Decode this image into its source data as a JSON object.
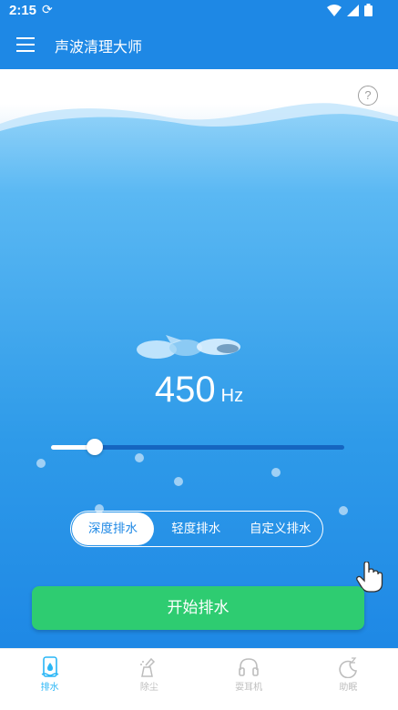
{
  "status": {
    "time": "2:15"
  },
  "app_bar": {
    "title": "声波清理大师"
  },
  "main": {
    "help_label": "?",
    "frequency_value": "450",
    "frequency_unit": "Hz",
    "slider_level": 0.15,
    "modes": [
      {
        "label": "深度排水",
        "active": true
      },
      {
        "label": "轻度排水",
        "active": false
      },
      {
        "label": "自定义排水",
        "active": false
      }
    ],
    "start_button": "开始排水"
  },
  "bottom_nav": [
    {
      "label": "排水",
      "icon": "drain-phone-icon",
      "active": true
    },
    {
      "label": "除尘",
      "icon": "dust-clean-icon",
      "active": false
    },
    {
      "label": "耍耳机",
      "icon": "headphones-icon",
      "active": false
    },
    {
      "label": "助眠",
      "icon": "sleep-moon-icon",
      "active": false
    }
  ],
  "colors": {
    "primary": "#1e88e5",
    "start_button": "#2ecc71",
    "nav_active": "#29b6f6"
  }
}
